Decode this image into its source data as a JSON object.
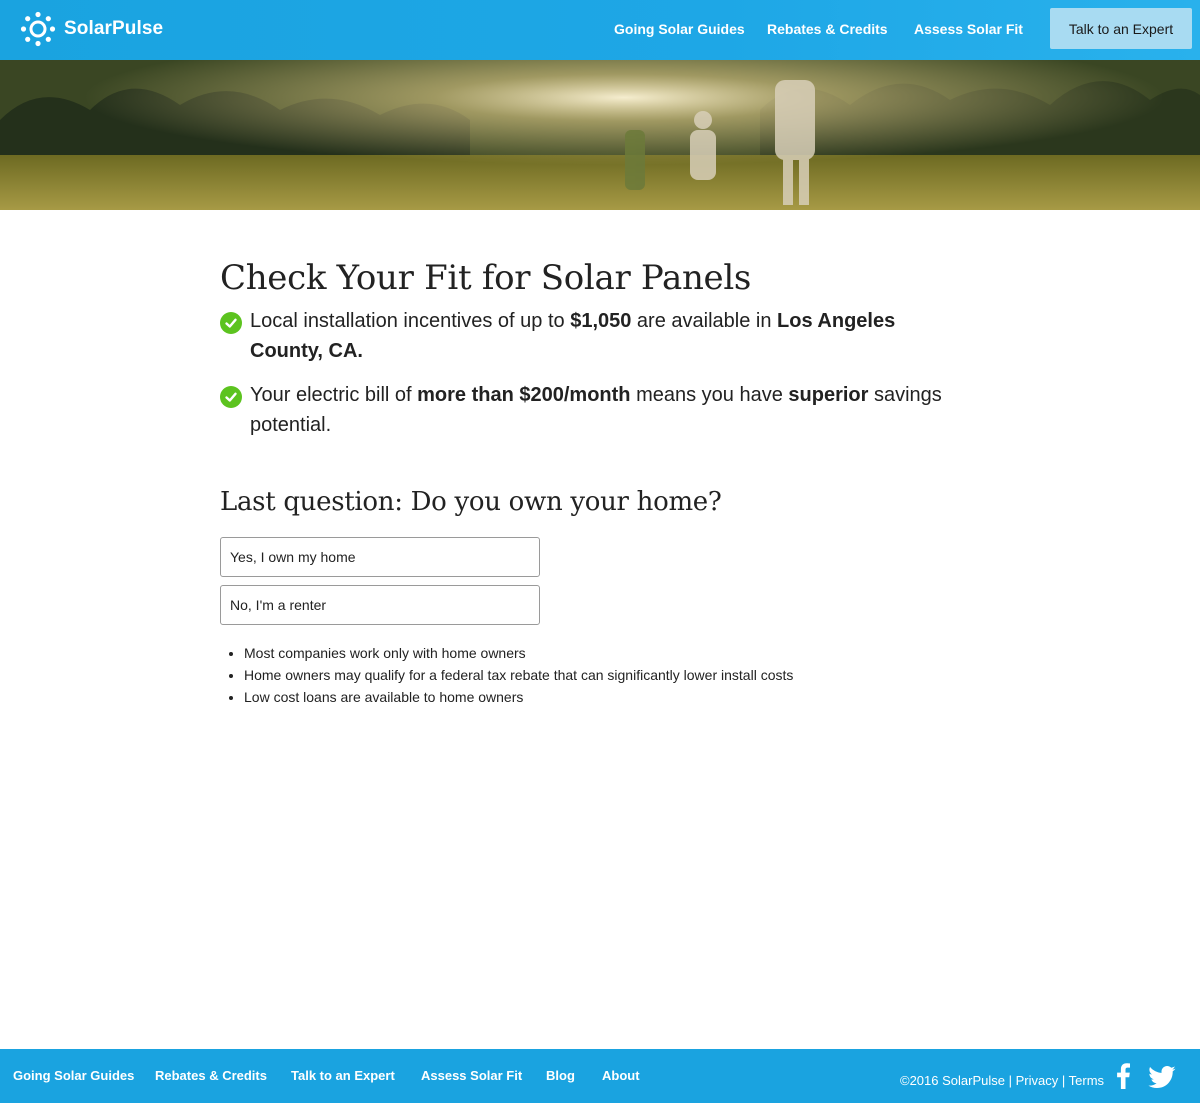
{
  "header": {
    "brand": "SolarPulse",
    "nav": [
      "Going Solar Guides",
      "Rebates & Credits",
      "Assess Solar Fit"
    ],
    "cta_label": "Talk to an Expert"
  },
  "main": {
    "title": "Check Your Fit for Solar Panels",
    "fit_items": [
      {
        "pre": "Local installation incentives of up to ",
        "b1": "$1,050",
        "mid": " are available in ",
        "b2": "Los Angeles County, CA.",
        "post": ""
      },
      {
        "pre": "Your electric bill of ",
        "b1": "more than $200/month",
        "mid": " means you have ",
        "b2": "superior",
        "post": " savings potential."
      }
    ],
    "question": "Last question: Do you own your home?",
    "options": [
      "Yes, I own my home",
      "No, I'm a renter"
    ],
    "benefits": [
      "Most companies work only with home owners",
      "Home owners may qualify for a federal tax rebate that can significantly lower install costs",
      "Low cost loans are available to home owners"
    ]
  },
  "footer": {
    "links": [
      "Going Solar Guides",
      "Rebates & Credits",
      "Talk to an Expert",
      "Assess Solar Fit",
      "Blog",
      "About"
    ],
    "copyright": "©2016 SolarPulse",
    "sep": "|",
    "privacy": "Privacy",
    "terms": "Terms"
  },
  "colors": {
    "brand_blue": "#1aa3e0",
    "cta_bg": "#a8dbf2",
    "check_green": "#5cc31f"
  },
  "icons": [
    "sun-logo-icon",
    "check-icon",
    "facebook-icon",
    "twitter-icon"
  ]
}
